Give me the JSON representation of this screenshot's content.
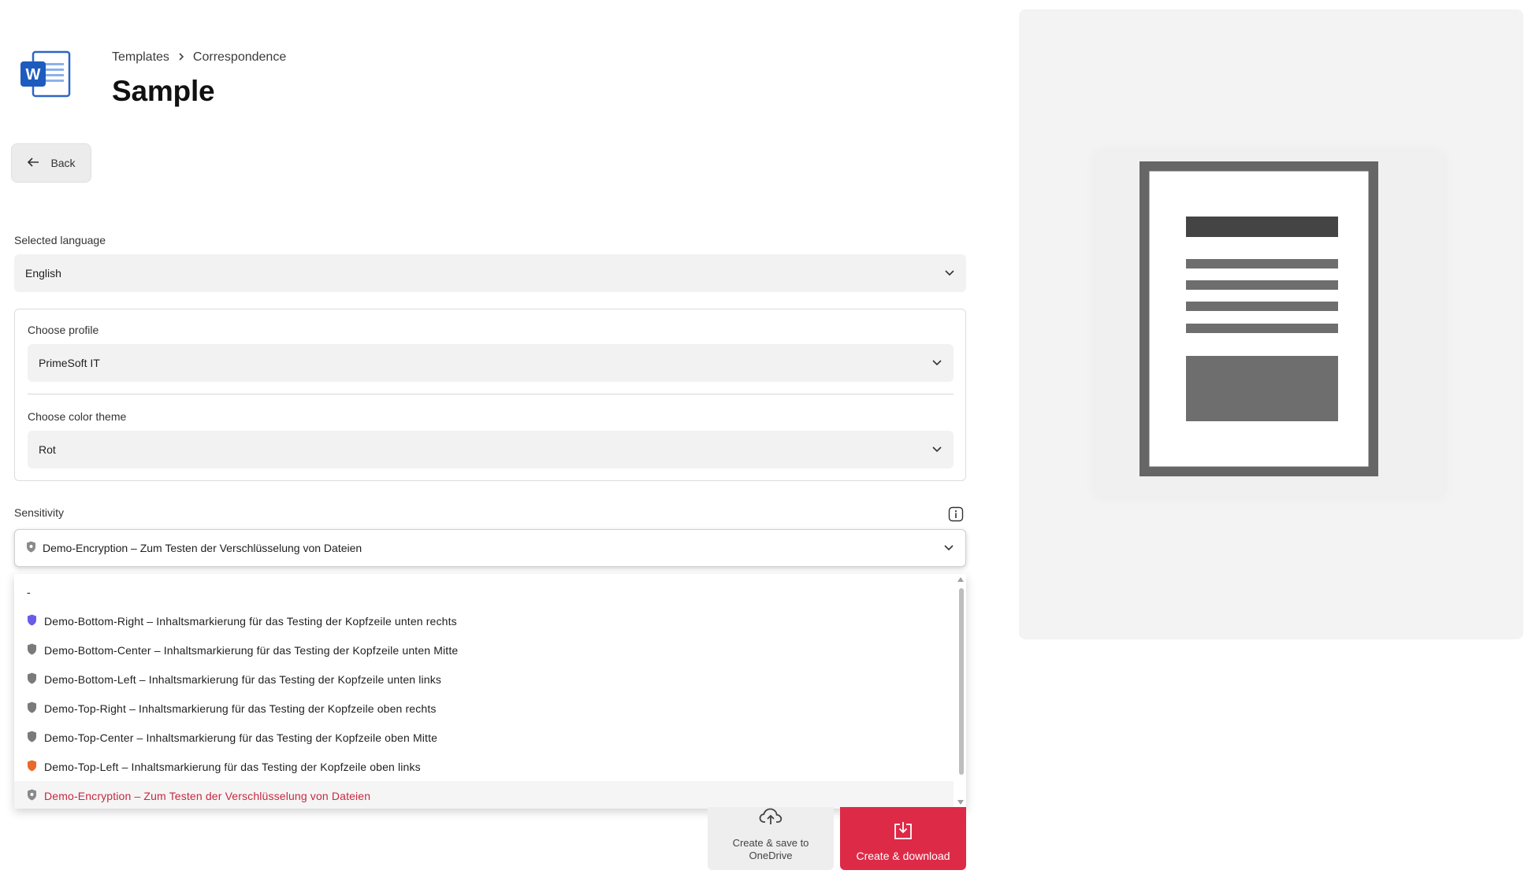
{
  "header": {
    "breadcrumb": [
      "Templates",
      "Correspondence"
    ],
    "title": "Sample",
    "app_icon": "word-icon"
  },
  "back_button": {
    "label": "Back",
    "icon": "arrow-left-icon"
  },
  "language": {
    "label": "Selected language",
    "value": "English"
  },
  "profile": {
    "label": "Choose profile",
    "value": "PrimeSoft IT"
  },
  "color_theme": {
    "label": "Choose color theme",
    "value": "Rot"
  },
  "sensitivity": {
    "label": "Sensitivity",
    "value": "Demo-Encryption – Zum Testen der Verschlüsselung von Dateien",
    "options": [
      {
        "label": "-",
        "shield_color": null
      },
      {
        "label": "Demo-Bottom-Right – Inhaltsmarkierung für das Testing der Kopfzeile unten rechts",
        "shield_color": "#6b5ce7"
      },
      {
        "label": "Demo-Bottom-Center – Inhaltsmarkierung für das Testing der Kopfzeile unten Mitte",
        "shield_color": "#7a7a7a"
      },
      {
        "label": "Demo-Bottom-Left – Inhaltsmarkierung für das Testing der Kopfzeile unten links",
        "shield_color": "#7a7a7a"
      },
      {
        "label": "Demo-Top-Right – Inhaltsmarkierung für das Testing der Kopfzeile oben rechts",
        "shield_color": "#7a7a7a"
      },
      {
        "label": "Demo-Top-Center – Inhaltsmarkierung für das Testing der Kopfzeile oben Mitte",
        "shield_color": "#7a7a7a"
      },
      {
        "label": "Demo-Top-Left – Inhaltsmarkierung für das Testing der Kopfzeile oben links",
        "shield_color": "#e8692a"
      },
      {
        "label": "Demo-Encryption – Zum Testen der Verschlüsselung von Dateien",
        "shield_color": "#8a8a8a",
        "selected": true
      }
    ]
  },
  "actions": {
    "onedrive_label": "Create & save to OneDrive",
    "download_label": "Create & download"
  },
  "colors": {
    "accent": "#dd2a47",
    "selected_text": "#c8283f",
    "field_bg": "#f2f2f2"
  }
}
